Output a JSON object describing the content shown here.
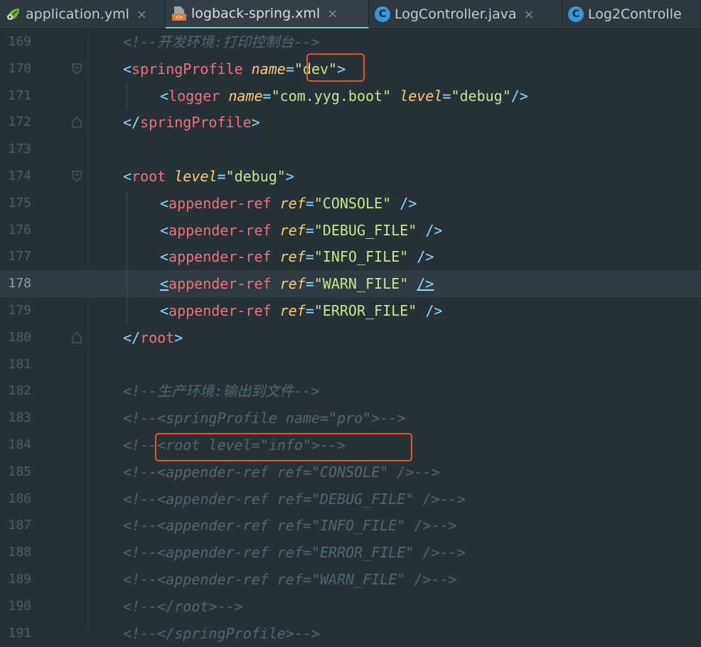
{
  "tabs": [
    {
      "label": "application.yml",
      "icon": "spring-leaf-icon",
      "active": false
    },
    {
      "label": "logback-spring.xml",
      "icon": "xml-file-icon",
      "active": true
    },
    {
      "label": "LogController.java",
      "icon": "java-class-icon",
      "active": false
    },
    {
      "label": "Log2Controlle",
      "icon": "java-class-icon",
      "active": false
    }
  ],
  "tab_close_glyph": "×",
  "class_icon_letter": "C",
  "editor": {
    "current_line": 178,
    "lines": [
      {
        "n": "169",
        "text": "<!--开发环境:打印控制台-->"
      },
      {
        "n": "170",
        "text": "<springProfile name=\"dev\">"
      },
      {
        "n": "171",
        "text": "<logger name=\"com.yyg.boot\" level=\"debug\"/>"
      },
      {
        "n": "172",
        "text": "</springProfile>"
      },
      {
        "n": "173",
        "text": ""
      },
      {
        "n": "174",
        "text": "<root level=\"debug\">"
      },
      {
        "n": "175",
        "text": "<appender-ref ref=\"CONSOLE\" />"
      },
      {
        "n": "176",
        "text": "<appender-ref ref=\"DEBUG_FILE\" />"
      },
      {
        "n": "177",
        "text": "<appender-ref ref=\"INFO_FILE\" />"
      },
      {
        "n": "178",
        "text": "<appender-ref ref=\"WARN_FILE\" />"
      },
      {
        "n": "179",
        "text": "<appender-ref ref=\"ERROR_FILE\" />"
      },
      {
        "n": "180",
        "text": "</root>"
      },
      {
        "n": "181",
        "text": ""
      },
      {
        "n": "182",
        "text": "<!--生产环境:输出到文件-->"
      },
      {
        "n": "183",
        "text": "<!--<springProfile name=\"pro\">-->"
      },
      {
        "n": "184",
        "text": "<!--<root level=\"info\">-->"
      },
      {
        "n": "185",
        "text": "<!--<appender-ref ref=\"CONSOLE\" />-->"
      },
      {
        "n": "186",
        "text": "<!--<appender-ref ref=\"DEBUG_FILE\" />-->"
      },
      {
        "n": "187",
        "text": "<!--<appender-ref ref=\"INFO_FILE\" />-->"
      },
      {
        "n": "188",
        "text": "<!--<appender-ref ref=\"ERROR_FILE\" />-->"
      },
      {
        "n": "189",
        "text": "<!--<appender-ref ref=\"WARN_FILE\" />-->"
      },
      {
        "n": "190",
        "text": "<!--</root>-->"
      },
      {
        "n": "191",
        "text": "<!--</springProfile>-->"
      }
    ]
  },
  "colors": {
    "background": "#263238",
    "tag": "#89ddff",
    "tag_name": "#f07178",
    "attribute": "#ffcb6b",
    "value": "#c3e88d",
    "comment": "#4f6571",
    "highlight_box": "#e0582a"
  }
}
